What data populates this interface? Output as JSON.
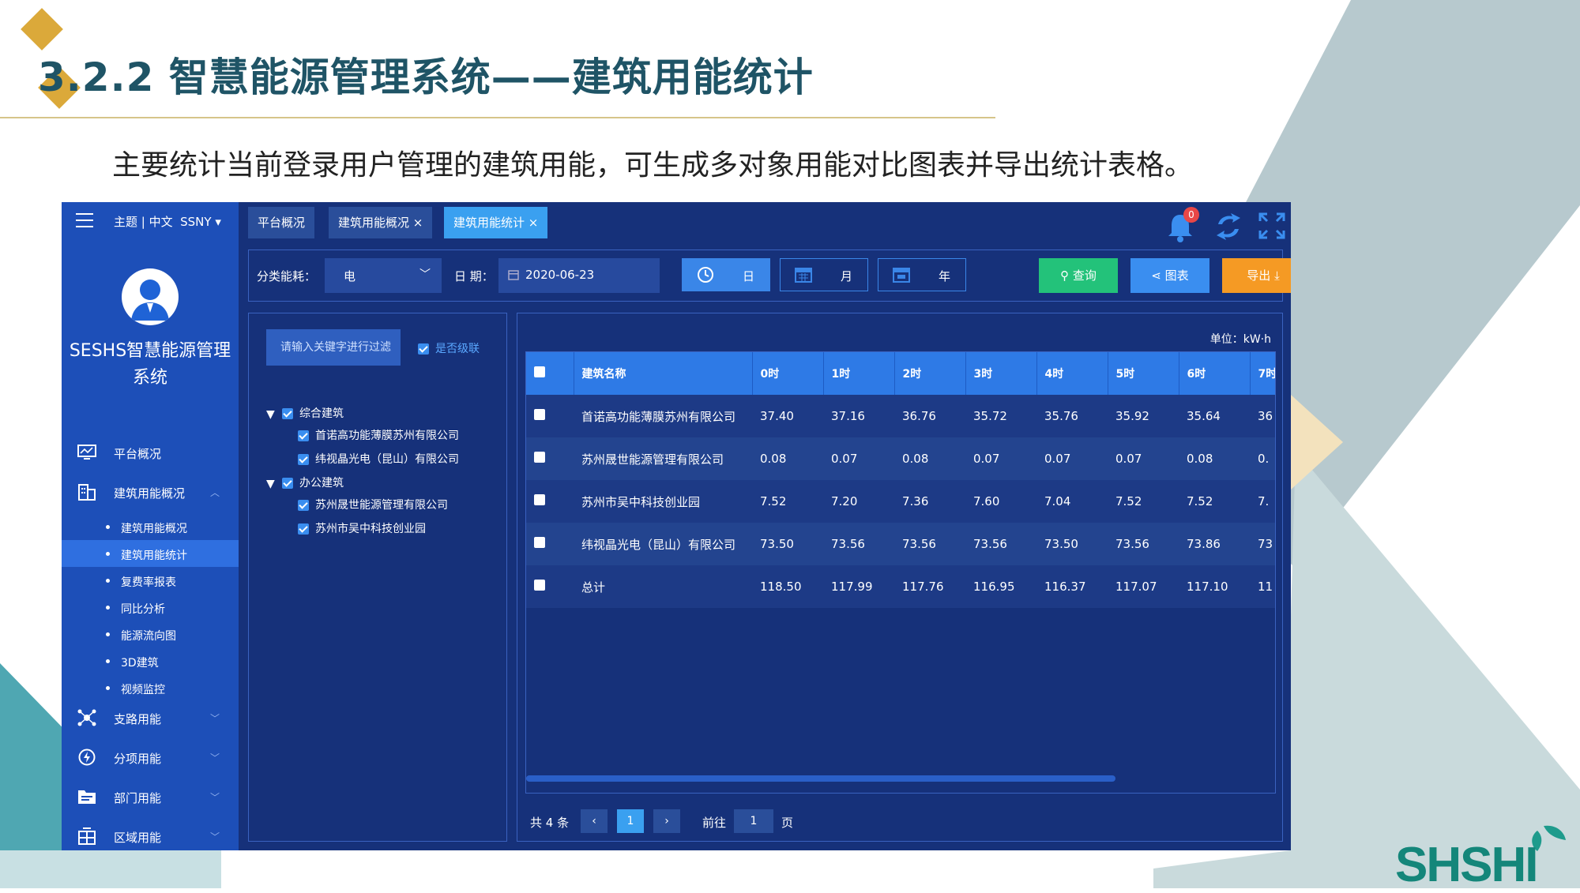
{
  "slide": {
    "title": "3.2.2  智慧能源管理系统——建筑用能统计",
    "subtitle": "主要统计当前登录用户管理的建筑用能，可生成多对象用能对比图表并导出统计表格。",
    "logo_text": "SHSHI",
    "colors": {
      "title": "#1f5466",
      "accent": "#dba93a",
      "frame": "#16317a",
      "sidebar": "#1d4fb8"
    }
  },
  "app": {
    "top_bar": {
      "theme_lang": "主题 | 中文",
      "user": "SSNY ▾"
    },
    "system_name": "SESHS智慧能源管理系统",
    "nav": [
      {
        "label": "平台概况",
        "icon": "monitor-icon"
      },
      {
        "label": "建筑用能概况",
        "icon": "building-icon",
        "expanded": true
      },
      {
        "label": "支路用能",
        "icon": "network-icon"
      },
      {
        "label": "分项用能",
        "icon": "bolt-icon"
      },
      {
        "label": "部门用能",
        "icon": "folder-icon"
      },
      {
        "label": "区域用能",
        "icon": "region-icon"
      }
    ],
    "subnav": [
      {
        "label": "建筑用能概况"
      },
      {
        "label": "建筑用能统计",
        "active": true
      },
      {
        "label": "复费率报表"
      },
      {
        "label": "同比分析"
      },
      {
        "label": "能源流向图"
      },
      {
        "label": "3D建筑"
      },
      {
        "label": "视频监控"
      }
    ],
    "tabs": [
      {
        "label": "平台概况"
      },
      {
        "label": "建筑用能概况 ×"
      },
      {
        "label": "建筑用能统计 ×",
        "active": true
      }
    ],
    "notification_count": "0",
    "toolbar": {
      "category_label": "分类能耗：",
      "category_value": "电",
      "date_label": "日 期：",
      "date_value": "2020-06-23",
      "day": "日",
      "month": "月",
      "year": "年",
      "query": "查询",
      "chart": "图表",
      "export": "导出"
    },
    "tree": {
      "search_placeholder": "请输入关键字进行过滤",
      "cascade_label": "是否级联",
      "groups": [
        {
          "label": "综合建筑",
          "children": [
            "首诺高功能薄膜苏州有限公司",
            "纬视晶光电（昆山）有限公司"
          ]
        },
        {
          "label": "办公建筑",
          "children": [
            "苏州晟世能源管理有限公司",
            "苏州市吴中科技创业园"
          ]
        }
      ]
    },
    "table": {
      "unit": "单位：kW·h",
      "headers": [
        "建筑名称",
        "0时",
        "1时",
        "2时",
        "3时",
        "4时",
        "5时",
        "6时",
        "7时"
      ],
      "rows": [
        [
          "首诺高功能薄膜苏州有限公司",
          "37.40",
          "37.16",
          "36.76",
          "35.72",
          "35.76",
          "35.92",
          "35.64",
          "36"
        ],
        [
          "苏州晟世能源管理有限公司",
          "0.08",
          "0.07",
          "0.08",
          "0.07",
          "0.07",
          "0.07",
          "0.08",
          "0."
        ],
        [
          "苏州市吴中科技创业园",
          "7.52",
          "7.20",
          "7.36",
          "7.60",
          "7.04",
          "7.52",
          "7.52",
          "7."
        ],
        [
          "纬视晶光电（昆山）有限公司",
          "73.50",
          "73.56",
          "73.56",
          "73.56",
          "73.50",
          "73.56",
          "73.86",
          "73"
        ],
        [
          "总计",
          "118.50",
          "117.99",
          "117.76",
          "116.95",
          "116.37",
          "117.07",
          "117.10",
          "11"
        ]
      ]
    },
    "pager": {
      "total": "共 4 条",
      "prev": "‹",
      "page": "1",
      "next": "›",
      "goto_label": "前往",
      "goto_value": "1",
      "goto_suffix": "页"
    }
  }
}
